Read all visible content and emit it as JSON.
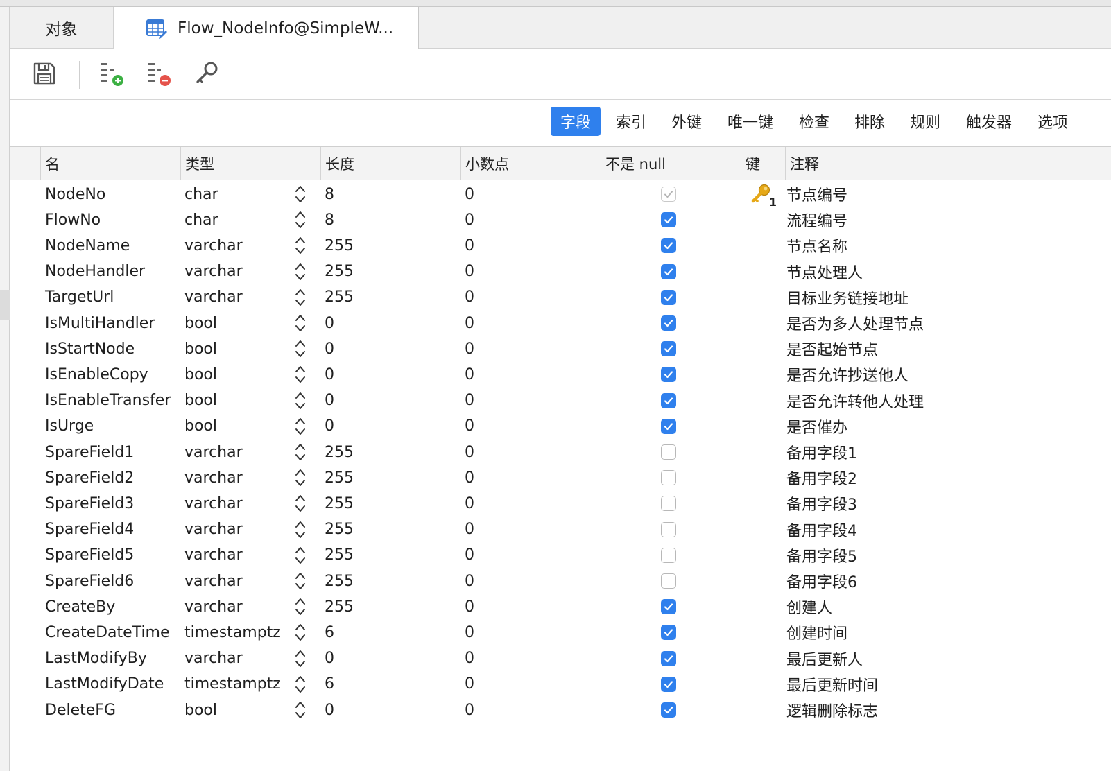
{
  "tabs": {
    "objects_label": "对象",
    "active_label": "Flow_NodeInfo@SimpleW..."
  },
  "toolbar": {
    "save_icon": "save-icon",
    "add_field_icon": "add-field-icon",
    "delete_field_icon": "delete-field-icon",
    "primary_key_icon": "primary-key-icon"
  },
  "subtabs": [
    {
      "label": "字段",
      "active": true
    },
    {
      "label": "索引",
      "active": false
    },
    {
      "label": "外键",
      "active": false
    },
    {
      "label": "唯一键",
      "active": false
    },
    {
      "label": "检查",
      "active": false
    },
    {
      "label": "排除",
      "active": false
    },
    {
      "label": "规则",
      "active": false
    },
    {
      "label": "触发器",
      "active": false
    },
    {
      "label": "选项",
      "active": false
    }
  ],
  "columns": {
    "name": "名",
    "type": "类型",
    "length": "长度",
    "decimal": "小数点",
    "not_null": "不是 null",
    "key": "键",
    "comment": "注释"
  },
  "key_badge": "1",
  "colors": {
    "accent": "#2f80ed",
    "key_gold": "#e6a817"
  },
  "rows": [
    {
      "name": "NodeNo",
      "type": "char",
      "length": "8",
      "decimal": "0",
      "not_null": "dim",
      "key": true,
      "comment": "节点编号"
    },
    {
      "name": "FlowNo",
      "type": "char",
      "length": "8",
      "decimal": "0",
      "not_null": "on",
      "key": false,
      "comment": "流程编号"
    },
    {
      "name": "NodeName",
      "type": "varchar",
      "length": "255",
      "decimal": "0",
      "not_null": "on",
      "key": false,
      "comment": "节点名称"
    },
    {
      "name": "NodeHandler",
      "type": "varchar",
      "length": "255",
      "decimal": "0",
      "not_null": "on",
      "key": false,
      "comment": "节点处理人"
    },
    {
      "name": "TargetUrl",
      "type": "varchar",
      "length": "255",
      "decimal": "0",
      "not_null": "on",
      "key": false,
      "comment": "目标业务链接地址"
    },
    {
      "name": "IsMultiHandler",
      "type": "bool",
      "length": "0",
      "decimal": "0",
      "not_null": "on",
      "key": false,
      "comment": "是否为多人处理节点"
    },
    {
      "name": "IsStartNode",
      "type": "bool",
      "length": "0",
      "decimal": "0",
      "not_null": "on",
      "key": false,
      "comment": "是否起始节点"
    },
    {
      "name": "IsEnableCopy",
      "type": "bool",
      "length": "0",
      "decimal": "0",
      "not_null": "on",
      "key": false,
      "comment": "是否允许抄送他人"
    },
    {
      "name": "IsEnableTransfer",
      "type": "bool",
      "length": "0",
      "decimal": "0",
      "not_null": "on",
      "key": false,
      "comment": "是否允许转他人处理"
    },
    {
      "name": "IsUrge",
      "type": "bool",
      "length": "0",
      "decimal": "0",
      "not_null": "on",
      "key": false,
      "comment": "是否催办"
    },
    {
      "name": "SpareField1",
      "type": "varchar",
      "length": "255",
      "decimal": "0",
      "not_null": "off",
      "key": false,
      "comment": "备用字段1"
    },
    {
      "name": "SpareField2",
      "type": "varchar",
      "length": "255",
      "decimal": "0",
      "not_null": "off",
      "key": false,
      "comment": "备用字段2"
    },
    {
      "name": "SpareField3",
      "type": "varchar",
      "length": "255",
      "decimal": "0",
      "not_null": "off",
      "key": false,
      "comment": "备用字段3"
    },
    {
      "name": "SpareField4",
      "type": "varchar",
      "length": "255",
      "decimal": "0",
      "not_null": "off",
      "key": false,
      "comment": "备用字段4"
    },
    {
      "name": "SpareField5",
      "type": "varchar",
      "length": "255",
      "decimal": "0",
      "not_null": "off",
      "key": false,
      "comment": "备用字段5"
    },
    {
      "name": "SpareField6",
      "type": "varchar",
      "length": "255",
      "decimal": "0",
      "not_null": "off",
      "key": false,
      "comment": "备用字段6"
    },
    {
      "name": "CreateBy",
      "type": "varchar",
      "length": "255",
      "decimal": "0",
      "not_null": "on",
      "key": false,
      "comment": "创建人"
    },
    {
      "name": "CreateDateTime",
      "type": "timestamptz",
      "length": "6",
      "decimal": "0",
      "not_null": "on",
      "key": false,
      "comment": "创建时间"
    },
    {
      "name": "LastModifyBy",
      "type": "varchar",
      "length": "0",
      "decimal": "0",
      "not_null": "on",
      "key": false,
      "comment": "最后更新人"
    },
    {
      "name": "LastModifyDate",
      "type": "timestamptz",
      "length": "6",
      "decimal": "0",
      "not_null": "on",
      "key": false,
      "comment": "最后更新时间"
    },
    {
      "name": "DeleteFG",
      "type": "bool",
      "length": "0",
      "decimal": "0",
      "not_null": "on",
      "key": false,
      "comment": "逻辑删除标志"
    }
  ]
}
